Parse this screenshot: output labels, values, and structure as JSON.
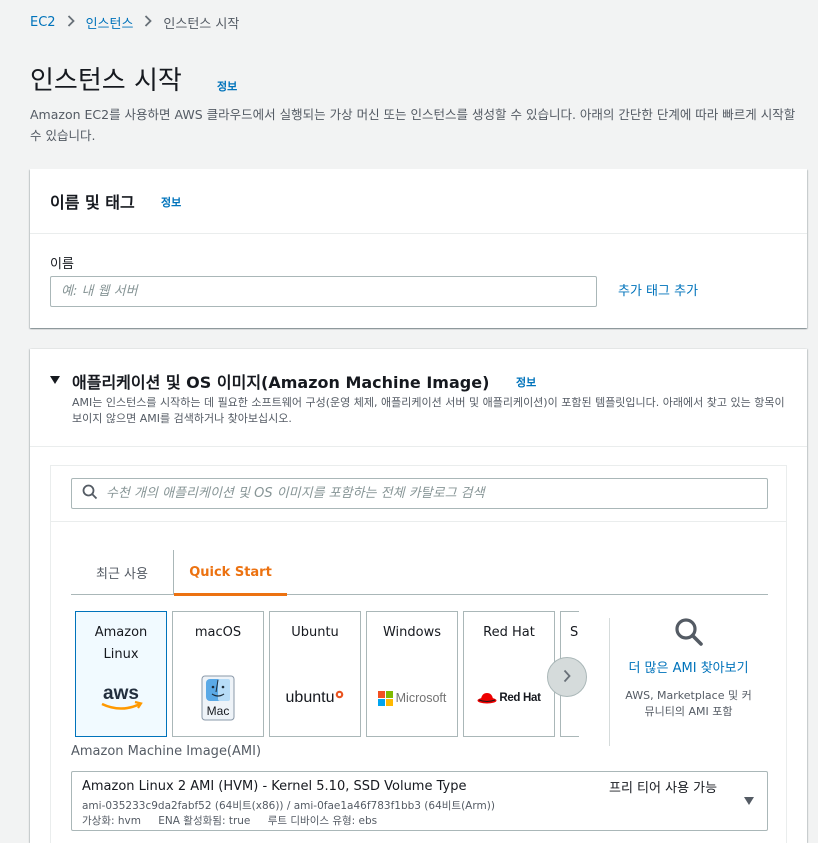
{
  "breadcrumb": {
    "items": [
      "EC2",
      "인스턴스",
      "인스턴스 시작"
    ]
  },
  "page": {
    "title": "인스턴스 시작",
    "info": "정보",
    "description": "Amazon EC2를 사용하면 AWS 클라우드에서 실행되는 가상 머신 또는 인스턴스를 생성할 수 있습니다. 아래의 간단한 단계에 따라 빠르게 시작할 수 있습니다."
  },
  "name_tags": {
    "title": "이름 및 태그",
    "info": "정보",
    "name_label": "이름",
    "name_placeholder": "예: 내 웹 서버",
    "add_tag": "추가 태그 추가"
  },
  "ami": {
    "title": "애플리케이션 및 OS 이미지(Amazon Machine Image)",
    "info": "정보",
    "description": "AMI는 인스턴스를 시작하는 데 필요한 소프트웨어 구성(운영 체제, 애플리케이션 서버 및 애플리케이션)이 포함된 템플릿입니다. 아래에서 찾고 있는 항목이 보이지 않으면 AMI를 검색하거나 찾아보십시오.",
    "search_placeholder": "수천 개의 애플리케이션 및 OS 이미지를 포함하는 전체 카탈로그 검색",
    "tabs": [
      "최근 사용",
      "Quick Start"
    ],
    "active_tab": "Quick Start",
    "cards": [
      {
        "label": "Amazon Linux",
        "logo": "aws",
        "selected": true
      },
      {
        "label": "macOS",
        "logo": "Mac",
        "selected": false
      },
      {
        "label": "Ubuntu",
        "logo": "ubuntu",
        "selected": false
      },
      {
        "label": "Windows",
        "logo": "Microsoft",
        "selected": false
      },
      {
        "label": "Red Hat",
        "logo": "Red Hat",
        "selected": false
      },
      {
        "label": "S",
        "logo": "",
        "selected": false
      }
    ],
    "browse_more": "더 많은 AMI 찾아보기",
    "browse_more_sub": "AWS, Marketplace 및 커뮤니티의 AMI 포함",
    "ami_label": "Amazon Machine Image(AMI)",
    "selected_ami": {
      "name": "Amazon Linux 2 AMI (HVM) - Kernel 5.10, SSD Volume Type",
      "free_tier": "프리 티어 사용 가능",
      "ids": "ami-035233c9da2fabf52 (64비트(x86)) / ami-0fae1a46f783f1bb3 (64비트(Arm))",
      "virtualization": "가상화: hvm",
      "ena": "ENA 활성화됨: true",
      "root_device": "루트 디바이스 유형: ebs"
    }
  },
  "colors": {
    "link": "#0073bb",
    "accent": "#ec7211",
    "aws_orange": "#ff9900",
    "selected_bg": "#f1faff"
  }
}
